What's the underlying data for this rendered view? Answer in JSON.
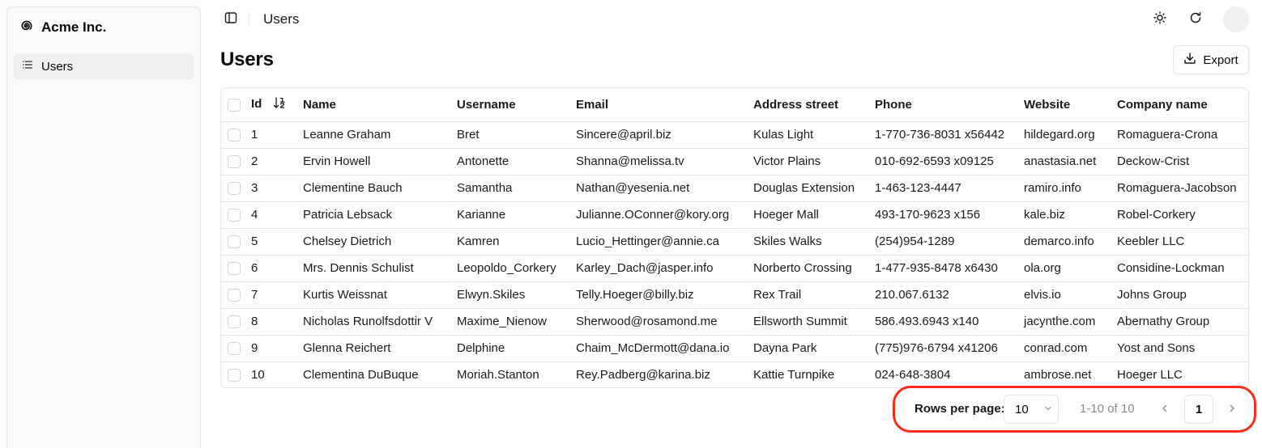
{
  "brand": {
    "name": "Acme Inc."
  },
  "sidebar": {
    "items": [
      {
        "label": "Users",
        "icon": "list-icon"
      }
    ]
  },
  "header": {
    "breadcrumb": "Users"
  },
  "page": {
    "title": "Users",
    "export_label": "Export"
  },
  "table": {
    "columns": [
      "Id",
      "Name",
      "Username",
      "Email",
      "Address street",
      "Phone",
      "Website",
      "Company name"
    ],
    "sort": {
      "column": "Id",
      "direction": "ascending"
    },
    "rows": [
      [
        "1",
        "Leanne Graham",
        "Bret",
        "Sincere@april.biz",
        "Kulas Light",
        "1-770-736-8031 x56442",
        "hildegard.org",
        "Romaguera-Crona"
      ],
      [
        "2",
        "Ervin Howell",
        "Antonette",
        "Shanna@melissa.tv",
        "Victor Plains",
        "010-692-6593 x09125",
        "anastasia.net",
        "Deckow-Crist"
      ],
      [
        "3",
        "Clementine Bauch",
        "Samantha",
        "Nathan@yesenia.net",
        "Douglas Extension",
        "1-463-123-4447",
        "ramiro.info",
        "Romaguera-Jacobson"
      ],
      [
        "4",
        "Patricia Lebsack",
        "Karianne",
        "Julianne.OConner@kory.org",
        "Hoeger Mall",
        "493-170-9623 x156",
        "kale.biz",
        "Robel-Corkery"
      ],
      [
        "5",
        "Chelsey Dietrich",
        "Kamren",
        "Lucio_Hettinger@annie.ca",
        "Skiles Walks",
        "(254)954-1289",
        "demarco.info",
        "Keebler LLC"
      ],
      [
        "6",
        "Mrs. Dennis Schulist",
        "Leopoldo_Corkery",
        "Karley_Dach@jasper.info",
        "Norberto Crossing",
        "1-477-935-8478 x6430",
        "ola.org",
        "Considine-Lockman"
      ],
      [
        "7",
        "Kurtis Weissnat",
        "Elwyn.Skiles",
        "Telly.Hoeger@billy.biz",
        "Rex Trail",
        "210.067.6132",
        "elvis.io",
        "Johns Group"
      ],
      [
        "8",
        "Nicholas Runolfsdottir V",
        "Maxime_Nienow",
        "Sherwood@rosamond.me",
        "Ellsworth Summit",
        "586.493.6943 x140",
        "jacynthe.com",
        "Abernathy Group"
      ],
      [
        "9",
        "Glenna Reichert",
        "Delphine",
        "Chaim_McDermott@dana.io",
        "Dayna Park",
        "(775)976-6794 x41206",
        "conrad.com",
        "Yost and Sons"
      ],
      [
        "10",
        "Clementina DuBuque",
        "Moriah.Stanton",
        "Rey.Padberg@karina.biz",
        "Kattie Turnpike",
        "024-648-3804",
        "ambrose.net",
        "Hoeger LLC"
      ]
    ]
  },
  "pagination": {
    "rows_per_page_label": "Rows per page:",
    "rows_per_page_value": "10",
    "range_text": "1-10 of 10",
    "current_page": "1"
  },
  "colors": {
    "highlight": "#ff2a1a",
    "border": "#e5e5e5",
    "muted_text": "#8a8a8a"
  }
}
